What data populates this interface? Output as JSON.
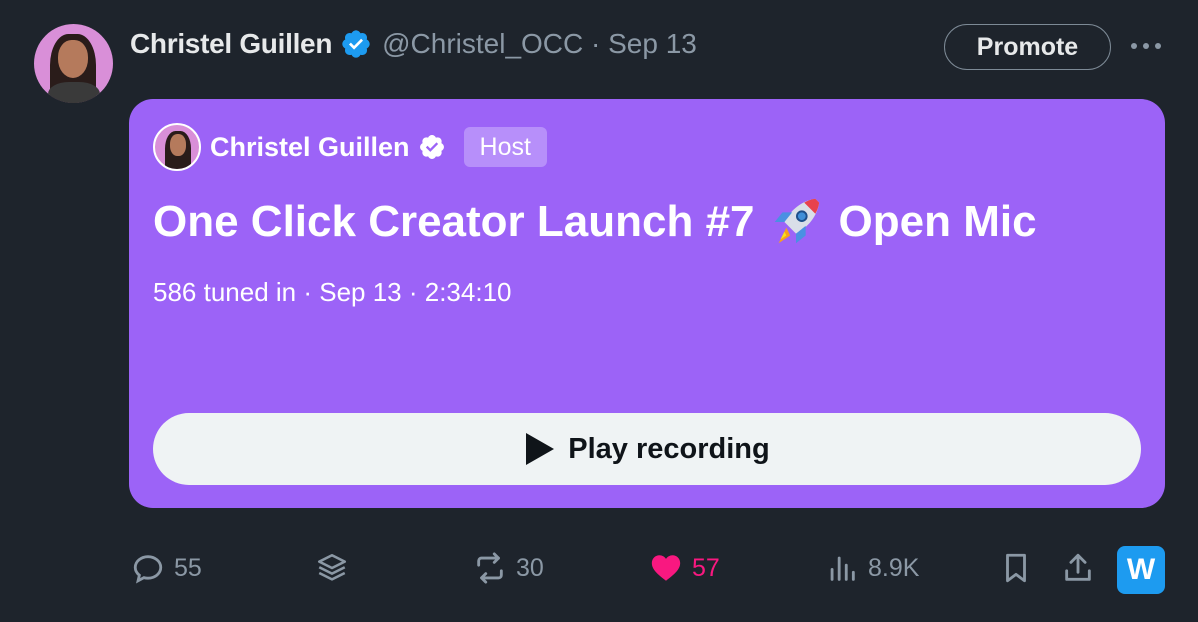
{
  "author": {
    "name": "Christel Guillen",
    "handle_date": "@Christel_OCC · Sep 13"
  },
  "promote_label": "Promote",
  "space": {
    "host_name": "Christel Guillen",
    "host_badge": "Host",
    "title_part1": "One Click Creator Launch #7",
    "title_part2": "Open Mic",
    "meta": "586 tuned in · Sep 13 · 2:34:10",
    "play_label": "Play recording",
    "card_color": "#9c63f7"
  },
  "stats": {
    "replies": "55",
    "reposts": "30",
    "likes": "57",
    "views": "8.9K"
  },
  "icons": [
    "verified-icon",
    "more-icon",
    "rocket-icon",
    "play-icon",
    "reply-icon",
    "layers-icon",
    "repost-icon",
    "heart-icon",
    "views-icon",
    "bookmark-icon",
    "share-icon",
    "w-app-icon"
  ],
  "w_logo_text": "W"
}
